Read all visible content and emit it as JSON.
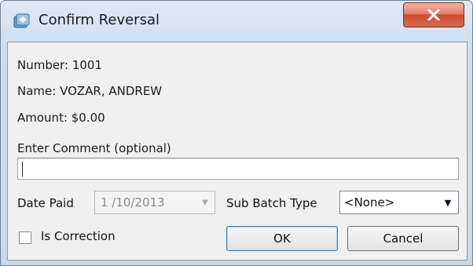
{
  "window": {
    "title": "Confirm Reversal",
    "close_label": "X"
  },
  "info": {
    "number": "Number: 1001",
    "name": "Name: VOZAR, ANDREW",
    "amount": "Amount: $0.00"
  },
  "comment": {
    "label": "Enter Comment (optional)",
    "value": ""
  },
  "date_paid": {
    "label": "Date Paid",
    "value": "1 /10/2013"
  },
  "sub_batch": {
    "label": "Sub Batch Type",
    "value": "<None>"
  },
  "correction": {
    "label": "Is Correction",
    "checked": false
  },
  "buttons": {
    "ok": "OK",
    "cancel": "Cancel"
  }
}
